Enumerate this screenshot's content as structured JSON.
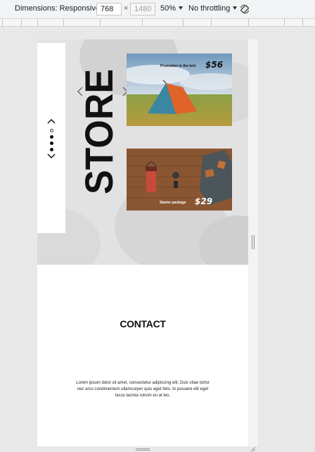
{
  "toolbar": {
    "dimensions_label": "Dimensions: Responsive",
    "width_value": "768",
    "times": "×",
    "height_value": "1480",
    "zoom": "50%",
    "throttling": "No throttling",
    "rotate_icon": "rotate-icon"
  },
  "page": {
    "store_title": "STORE",
    "carousel_prev_icon": "chevron-up-icon",
    "carousel_next_icon": "chevron-down-icon",
    "slider_prev_icon": "chevron-left-icon",
    "slider_next_icon": "chevron-right-icon",
    "cards": [
      {
        "label": "Promotion in the tent",
        "price": "$56"
      },
      {
        "label": "Starter package",
        "price": "$29"
      }
    ],
    "contact": {
      "title": "CONTACT",
      "text": "Lorem ipsum dolor sit amet, consectetur adipiscing elit. Duis vitae tortor nec arcu condimentum ullamcorper quis eget felis. In posuere elit eget lacus lacinia rutrum eu at leo."
    }
  },
  "colors": {
    "accent_black": "#111111",
    "hero_bg": "#e2e2e2",
    "tent_orange": "#e0632a",
    "tent_teal": "#2f6f86"
  }
}
